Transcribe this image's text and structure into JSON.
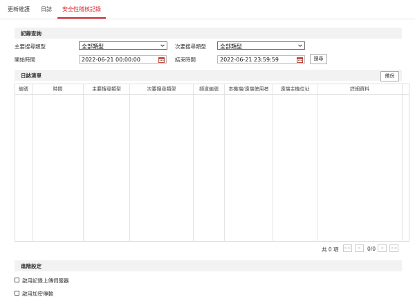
{
  "tabs": [
    {
      "label": "更新維護"
    },
    {
      "label": "日誌"
    },
    {
      "label": "安全性稽核記錄"
    }
  ],
  "query": {
    "title": "記錄查詢",
    "main_type_label": "主要搜尋類型",
    "main_type_value": "全部類型",
    "sub_type_label": "次要搜尋類型",
    "sub_type_value": "全部類型",
    "start_label": "開始時間",
    "start_value": "2022-06-21 00:00:00",
    "end_label": "結束時間",
    "end_value": "2022-06-21 23:59:59",
    "search_button": "搜尋"
  },
  "log": {
    "title": "日誌清單",
    "backup_button": "備份",
    "columns": [
      "編號",
      "時間",
      "主要搜尋類型",
      "次要搜尋類型",
      "頻道編號",
      "本機端/遠端使用者",
      "遠端主機位址",
      "詳細資料"
    ],
    "total": "共 0 項",
    "page": "0/0",
    "first_label": "<<",
    "prev_label": "<",
    "next_label": ">",
    "last_label": ">>"
  },
  "advanced": {
    "title": "進階設定",
    "option1": "啟用記錄上傳伺服器",
    "option2": "啟用加密傳輸"
  },
  "colors": {
    "accent": "#d4272e",
    "section_bg": "#f2f2f2"
  }
}
